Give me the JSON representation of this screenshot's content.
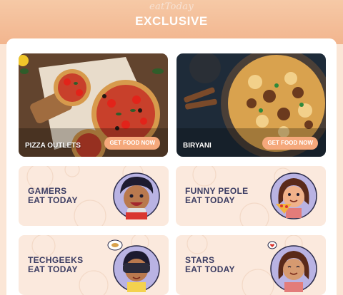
{
  "header": {
    "brand": "eatToday",
    "title": "EXCLUSIVE"
  },
  "food_cards": [
    {
      "label": "PIZZA OUTLETS",
      "button": "GET FOOD NOW"
    },
    {
      "label": "BIRYANI",
      "button": "GET FOOD NOW"
    }
  ],
  "categories": [
    {
      "line1": "GAMERS",
      "line2": "EAT TODAY",
      "icon": "gamer-avatar-icon"
    },
    {
      "line1": "FUNNY PEOLE",
      "line2": "EAT TODAY",
      "icon": "pizza-girl-avatar-icon"
    },
    {
      "line1": "TECHGEEKS",
      "line2": "EAT TODAY",
      "icon": "vr-headset-avatar-icon"
    },
    {
      "line1": "STARS",
      "line2": "EAT TODAY",
      "icon": "star-girl-avatar-icon"
    }
  ],
  "colors": {
    "header": "#f2b58e",
    "card_bg": "#fbe9dd",
    "accent": "#f5a87b",
    "text": "#3c3d63",
    "avatar_bg": "#b9b3e3"
  }
}
